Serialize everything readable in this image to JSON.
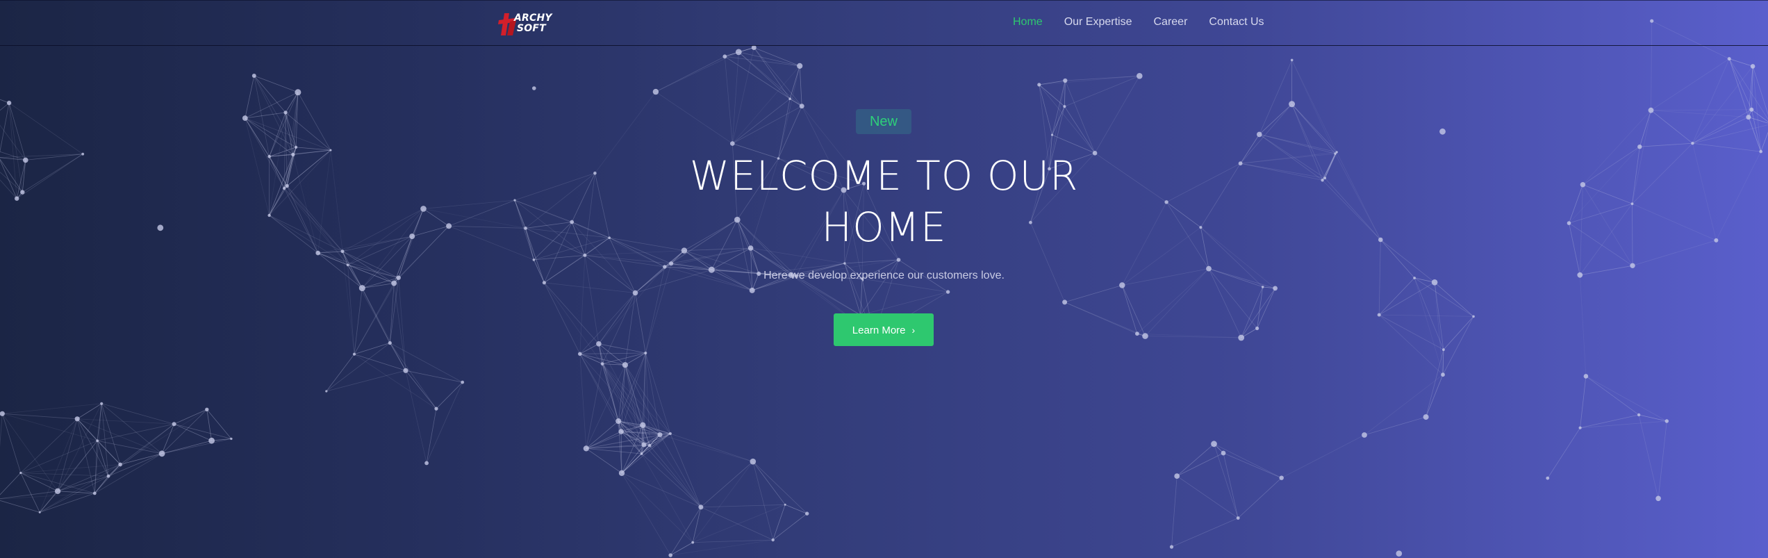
{
  "brand": {
    "logo_line1": "ARCHY",
    "logo_line2": "SOFT",
    "accent_color": "#2ec86f",
    "logo_color": "#d21f2b"
  },
  "nav": {
    "items": [
      {
        "label": "Home",
        "active": true
      },
      {
        "label": "Our Expertise",
        "active": false
      },
      {
        "label": "Career",
        "active": false
      },
      {
        "label": "Contact Us",
        "active": false
      }
    ]
  },
  "hero": {
    "badge": "New",
    "title_line1": "WELCOME TO OUR",
    "title_line2": "HOME",
    "subtitle": "Here we develop experience our customers love.",
    "cta_label": "Learn More",
    "cta_icon": "chevron-right-icon"
  },
  "background": {
    "gradient_start": "#1b2545",
    "gradient_end": "#5a5fcc",
    "particle_color": "#c4c8e6"
  }
}
